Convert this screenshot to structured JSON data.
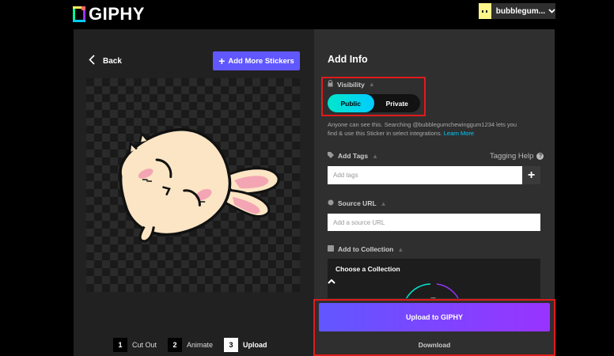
{
  "header": {
    "logo_text": "GIPHY",
    "username": "bubblegum...",
    "user_menu_chevron": "chevron-down-icon"
  },
  "left_panel": {
    "back_label": "Back",
    "add_stickers_label": "Add More Stickers",
    "steps": [
      {
        "num": "1",
        "label": "Cut Out",
        "active": false
      },
      {
        "num": "2",
        "label": "Animate",
        "active": false
      },
      {
        "num": "3",
        "label": "Upload",
        "active": true
      }
    ]
  },
  "right_panel": {
    "title": "Add Info",
    "visibility": {
      "label": "Visibility",
      "options": [
        "Public",
        "Private"
      ],
      "selected": "Public",
      "help_text": "Anyone can see this. Searching @bubblegumchewinggum1234 lets you find & use this Sticker in select integrations.",
      "learn_more": "Learn More"
    },
    "tags": {
      "label": "Add Tags",
      "help_label": "Tagging Help",
      "placeholder": "Add tags",
      "value": ""
    },
    "source": {
      "label": "Source URL",
      "placeholder": "Add a source URL",
      "value": ""
    },
    "collection": {
      "label": "Add to Collection",
      "dropdown_label": "Choose a Collection"
    },
    "upload_label": "Upload to GIPHY",
    "download_label": "Download"
  },
  "colors": {
    "accent_purple": "#6157ff",
    "accent_violet": "#9933ff",
    "accent_cyan": "#00ccff",
    "highlight_red": "#e01b1b"
  }
}
